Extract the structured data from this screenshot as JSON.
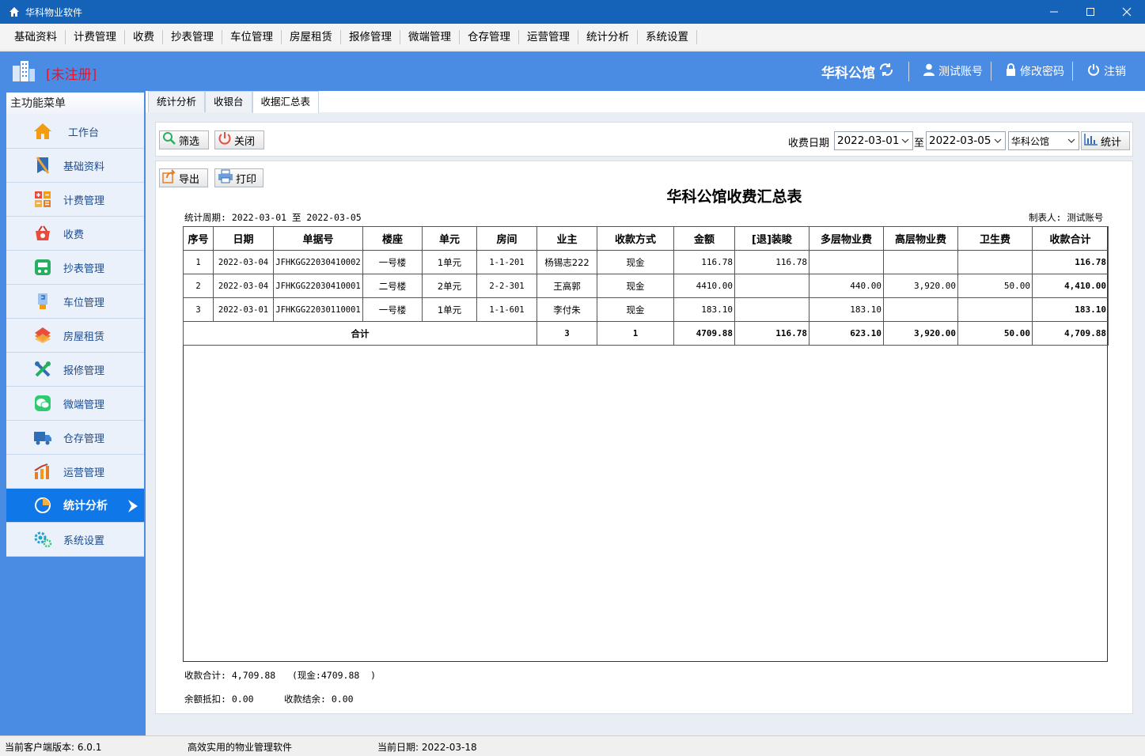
{
  "window": {
    "title": "华科物业软件",
    "controls": [
      "minimize",
      "maximize",
      "close"
    ]
  },
  "menubar": {
    "items": [
      "基础资料",
      "计费管理",
      "收费",
      "抄表管理",
      "车位管理",
      "房屋租赁",
      "报修管理",
      "微端管理",
      "仓存管理",
      "运营管理",
      "统计分析",
      "系统设置"
    ]
  },
  "header": {
    "unregistered": "[未注册]",
    "company": "华科公馆",
    "account": "测试账号",
    "change_password": "修改密码",
    "logout": "注销"
  },
  "sidebar": {
    "title": "主功能菜单",
    "items": [
      {
        "label": "工作台",
        "icon": "home-icon"
      },
      {
        "label": "基础资料",
        "icon": "book-icon"
      },
      {
        "label": "计费管理",
        "icon": "calculator-icon"
      },
      {
        "label": "收费",
        "icon": "basket-icon"
      },
      {
        "label": "抄表管理",
        "icon": "meter-icon"
      },
      {
        "label": "车位管理",
        "icon": "parking-icon"
      },
      {
        "label": "房屋租赁",
        "icon": "house-rent-icon"
      },
      {
        "label": "报修管理",
        "icon": "tools-icon"
      },
      {
        "label": "微端管理",
        "icon": "wechat-icon"
      },
      {
        "label": "仓存管理",
        "icon": "truck-icon"
      },
      {
        "label": "运营管理",
        "icon": "chart-people-icon"
      },
      {
        "label": "统计分析",
        "icon": "pie-chart-icon",
        "active": true
      },
      {
        "label": "系统设置",
        "icon": "gear-icon"
      }
    ]
  },
  "tabs": [
    {
      "label": "统计分析",
      "active": false
    },
    {
      "label": "收银台",
      "active": false
    },
    {
      "label": "收据汇总表",
      "active": true
    }
  ],
  "toolbar": {
    "filter_label": "筛选",
    "close_label": "关闭",
    "date_label": "收费日期",
    "date_from": "2022-03-01",
    "to_label": "至",
    "date_to": "2022-03-05",
    "project": "华科公馆",
    "stat_label": "统计"
  },
  "report_toolbar": {
    "export_label": "导出",
    "print_label": "打印"
  },
  "report": {
    "title": "华科公馆收费汇总表",
    "period": "统计周期: 2022-03-01 至 2022-03-05",
    "maker": "制表人: 测试账号",
    "columns": [
      "序号",
      "日期",
      "单据号",
      "楼座",
      "单元",
      "房间",
      "业主",
      "收款方式",
      "金额",
      "[退]装睃",
      "多层物业费",
      "高层物业费",
      "卫生费",
      "收款合计"
    ],
    "rows": [
      {
        "seq": "1",
        "date": "2022-03-04",
        "receipt": "JFHKGG22030410002",
        "building": "一号楼",
        "unit": "1单元",
        "room": "1-1-201",
        "owner": "杨锡志222",
        "method": "现金",
        "amount": "116.78",
        "deposit": "116.78",
        "multi_fee": "",
        "high_fee": "",
        "sanitation": "",
        "total": "116.78"
      },
      {
        "seq": "2",
        "date": "2022-03-04",
        "receipt": "JFHKGG22030410001",
        "building": "二号楼",
        "unit": "2单元",
        "room": "2-2-301",
        "owner": "王高郭",
        "method": "现金",
        "amount": "4410.00",
        "deposit": "",
        "multi_fee": "440.00",
        "high_fee": "3,920.00",
        "sanitation": "50.00",
        "total": "4,410.00"
      },
      {
        "seq": "3",
        "date": "2022-03-01",
        "receipt": "JFHKGG22030110001",
        "building": "一号楼",
        "unit": "1单元",
        "room": "1-1-601",
        "owner": "李付朱",
        "method": "现金",
        "amount": "183.10",
        "deposit": "",
        "multi_fee": "183.10",
        "high_fee": "",
        "sanitation": "",
        "total": "183.10"
      }
    ],
    "totals": {
      "label": "合计",
      "owner_count": "3",
      "method_count": "1",
      "amount": "4709.88",
      "deposit": "116.78",
      "multi_fee": "623.10",
      "high_fee": "3,920.00",
      "sanitation": "50.00",
      "total": "4,709.88"
    },
    "footer": {
      "sum_line": "收款合计: 4,709.88   (现金:4709.88  )",
      "deduct": "余额抵扣: 0.00",
      "balance": "收款结余: 0.00"
    }
  },
  "statusbar": {
    "version": "当前客户端版本: 6.0.1",
    "slogan": "高效实用的物业管理软件",
    "date": "当前日期: 2022-03-18"
  },
  "colors": {
    "titlebar": "#1463b9",
    "header": "#4a8be3",
    "active_nav": "#0f77e8",
    "unregistered": "#e8152c"
  }
}
